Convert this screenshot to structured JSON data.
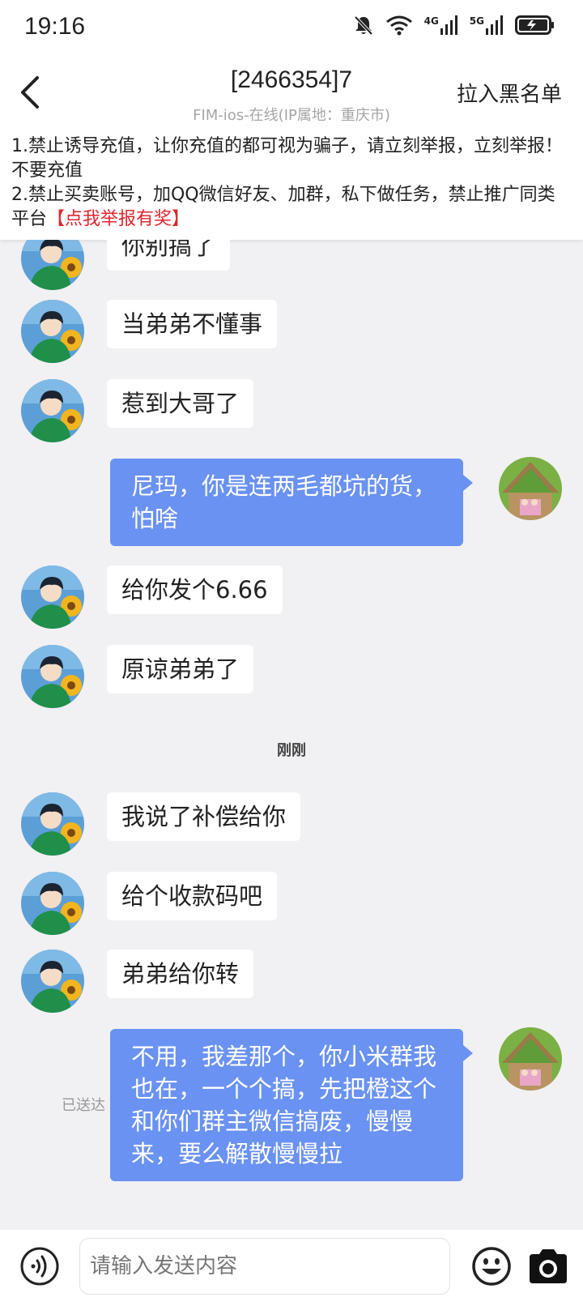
{
  "status_bar": {
    "time": "19:16",
    "net1": "4G",
    "net2": "5G"
  },
  "header": {
    "title": "[2466354]7",
    "subtitle": "FIM-ios-在线(IP属地：重庆市)",
    "blacklist_label": "拉入黑名单"
  },
  "notice": {
    "line1": "1.禁止诱导充值，让你充值的都可视为骗子，请立刻举报，立刻举报！不要充值",
    "line2": "2.禁止买卖账号，加QQ微信好友、加群，私下做任务，禁止推广同类平台",
    "report_link": "【点我举报有奖】"
  },
  "messages": [
    {
      "side": "in",
      "text": "你别搞了"
    },
    {
      "side": "in",
      "text": "当弟弟不懂事"
    },
    {
      "side": "in",
      "text": "惹到大哥了"
    },
    {
      "side": "out",
      "text": "尼玛，你是连两毛都坑的货，怕啥"
    },
    {
      "side": "in",
      "text": "给你发个6.66"
    },
    {
      "side": "in",
      "text": "原谅弟弟了"
    },
    {
      "side": "in",
      "text": "我说了补偿给你"
    },
    {
      "side": "in",
      "text": "给个收款码吧"
    },
    {
      "side": "in",
      "text": "弟弟给你转"
    },
    {
      "side": "out",
      "text": "不用，我差那个，你小米群我也在，一个个搞，先把橙这个和你们群主微信搞废，慢慢来，要么解散慢慢拉"
    }
  ],
  "time_divider": "刚刚",
  "delivered_label": "已送达",
  "input": {
    "placeholder": "请输入发送内容",
    "value": ""
  },
  "colors": {
    "out_bubble": "#6a92f2",
    "report_link": "#e0262d",
    "background": "#f1f0f3"
  }
}
